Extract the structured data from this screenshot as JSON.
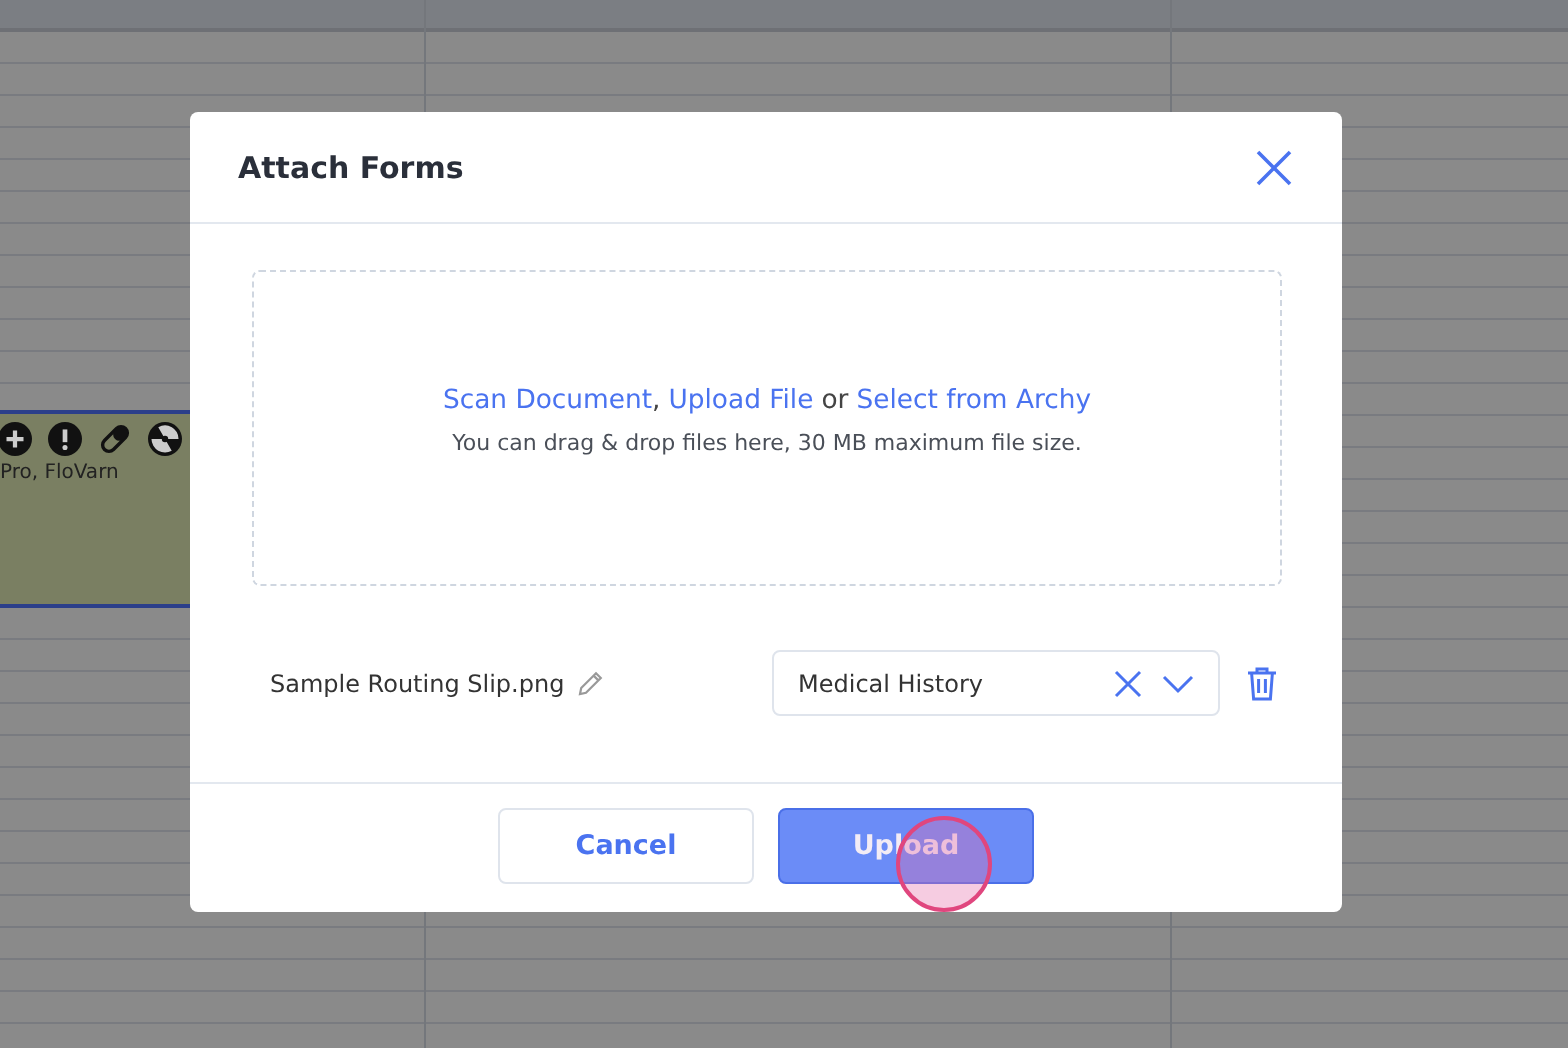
{
  "event": {
    "text": "Pro, FloVarn"
  },
  "dialog": {
    "title": "Attach Forms",
    "dropzone": {
      "links": [
        "Scan Document",
        "Upload File",
        "Select from Archy"
      ],
      "separators": [
        ",",
        "or"
      ],
      "hint": "You can drag & drop files here, 30 MB maximum file size."
    },
    "files": [
      {
        "name": "Sample Routing Slip.png",
        "category": "Medical History"
      }
    ],
    "buttons": [
      {
        "label": "Cancel",
        "kind": "secondary"
      },
      {
        "label": "Upload",
        "kind": "primary"
      }
    ]
  }
}
